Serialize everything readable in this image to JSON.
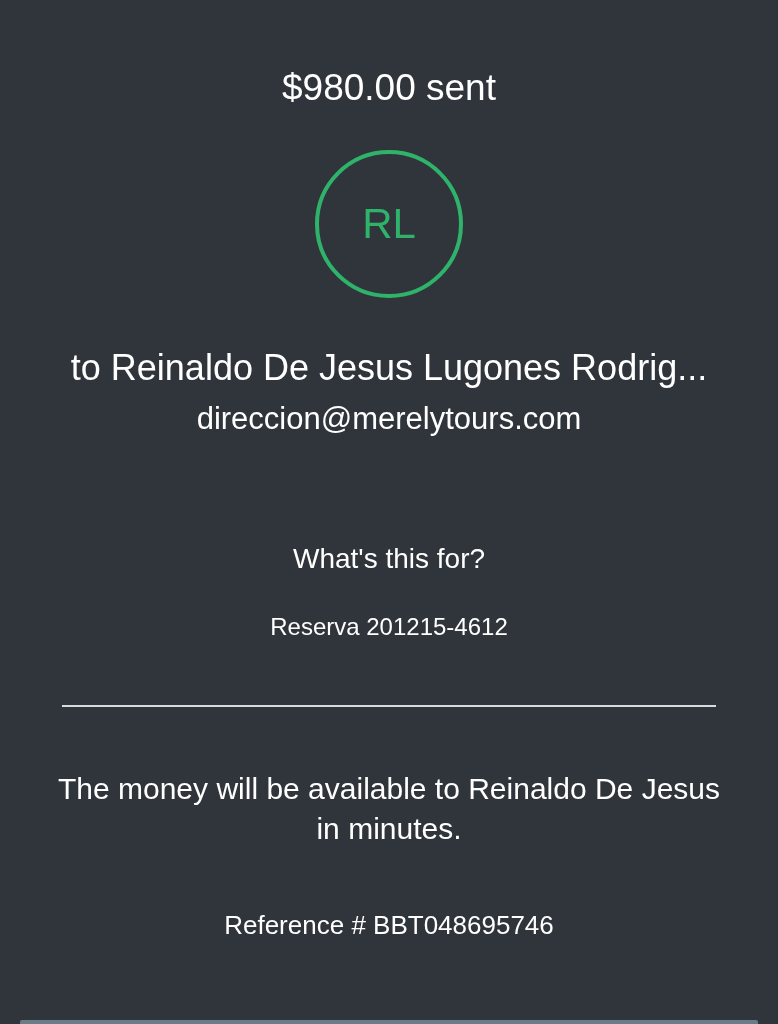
{
  "amount_title": "$980.00 sent",
  "recipient": {
    "initials": "RL",
    "name": "to Reinaldo De Jesus Lugones Rodrig...",
    "email": "direccion@merelytours.com"
  },
  "note": {
    "label": "What's this for?",
    "value": "Reserva 201215-4612"
  },
  "message": "The money will be available to Reinaldo De Jesus in minutes.",
  "reference": "Reference # BBT048695746"
}
